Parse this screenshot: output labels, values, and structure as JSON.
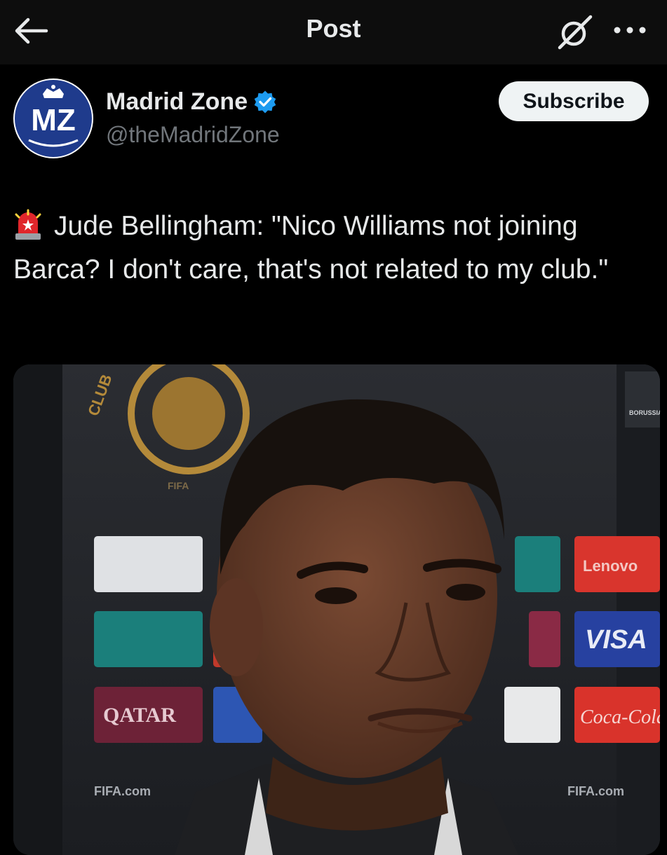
{
  "header": {
    "title": "Post",
    "back_icon": "arrow-left-icon",
    "grok_icon": "grok-icon",
    "more_icon": "more-horizontal-icon"
  },
  "post": {
    "author": {
      "name": "Madrid Zone",
      "handle": "@theMadridZone",
      "avatar_text": "MZ",
      "verified": true
    },
    "subscribe_label": "Subscribe",
    "emoji": "🚨",
    "text": "Jude Bellingham: \"Nico Williams not joining Barca? I don't care, that's not related to my club.\"",
    "media": {
      "sponsor_boards": [
        "Lenovo",
        "VISA",
        "QATAR",
        "Coca-Cola",
        "FIFA.com",
        "FIFA.com",
        "BORUSSIA",
        "FIFA"
      ]
    }
  },
  "colors": {
    "background": "#000000",
    "header_bg": "#0d0d0d",
    "text_primary": "#e7e9ea",
    "text_secondary": "#71767b",
    "verified_blue": "#1d9bf0",
    "subscribe_bg": "#eff3f4",
    "avatar_blue": "#1f3b8c"
  }
}
